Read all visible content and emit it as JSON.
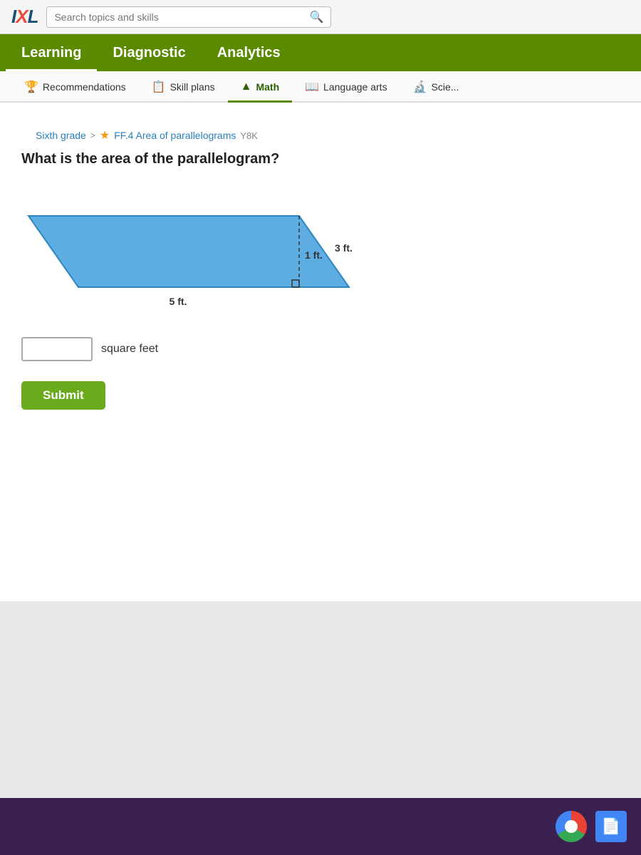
{
  "topbar": {
    "logo": "IXL",
    "search_placeholder": "Search topics and skills"
  },
  "main_nav": {
    "items": [
      {
        "id": "learning",
        "label": "Learning",
        "active": true
      },
      {
        "id": "diagnostic",
        "label": "Diagnostic",
        "active": false
      },
      {
        "id": "analytics",
        "label": "Analytics",
        "active": false
      }
    ]
  },
  "sub_nav": {
    "items": [
      {
        "id": "recommendations",
        "label": "Recommendations",
        "icon": "🏆",
        "active": false
      },
      {
        "id": "skill-plans",
        "label": "Skill plans",
        "icon": "📋",
        "active": false
      },
      {
        "id": "math",
        "label": "Math",
        "icon": "▲",
        "active": true
      },
      {
        "id": "language-arts",
        "label": "Language arts",
        "icon": "📖",
        "active": false
      },
      {
        "id": "science",
        "label": "Scie...",
        "icon": "🔬",
        "active": false
      }
    ]
  },
  "breadcrumb": {
    "grade": "Sixth grade",
    "chevron": ">",
    "star": "★",
    "skill_name": "FF.4 Area of parallelograms",
    "skill_code": "Y8K"
  },
  "question": {
    "title": "What is the area of the parallelogram?",
    "dimensions": {
      "height_label": "1 ft.",
      "base_label": "5 ft.",
      "slant_label": "3 ft."
    },
    "answer_placeholder": "",
    "answer_unit": "square feet"
  },
  "submit_button": {
    "label": "Submit"
  }
}
